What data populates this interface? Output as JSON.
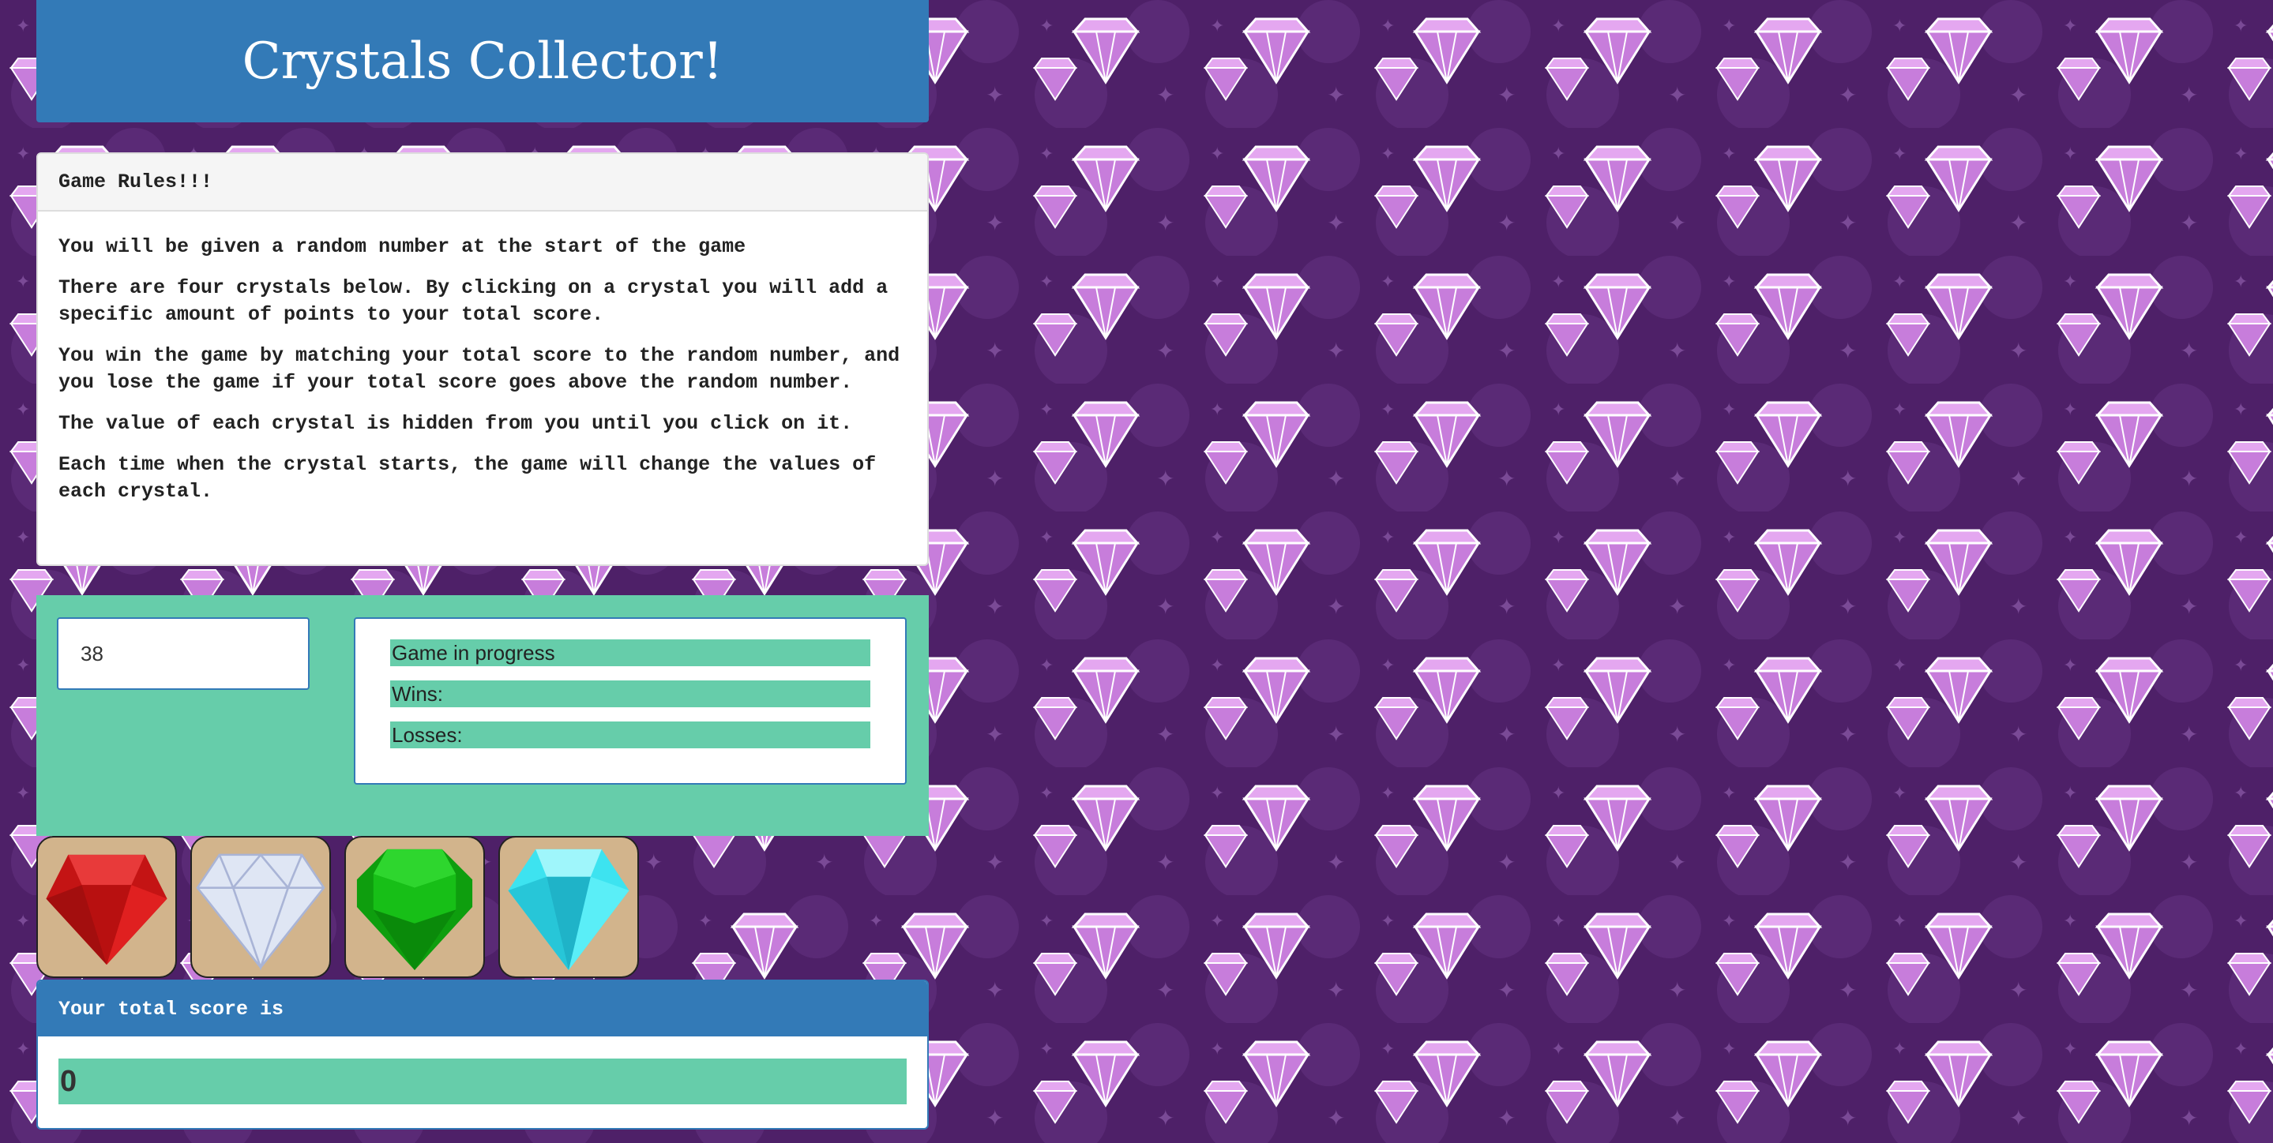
{
  "header": {
    "title": "Crystals Collector!"
  },
  "rules": {
    "heading": "Game Rules!!!",
    "items": [
      "You will be given a random number at the start of the game",
      "There are four crystals below. By clicking on a crystal you will add a specific amount of points to your total score.",
      "You win the game by matching your total score to the random number, and you lose the game if your total score goes above the random number.",
      "The value of each crystal is hidden from you until you click on it.",
      "Each time when the crystal starts, the game will change the values of each crystal."
    ]
  },
  "game": {
    "target_number": "38",
    "status": "Game in progress",
    "wins_label": "Wins:",
    "losses_label": "Losses:"
  },
  "crystals": [
    {
      "name": "red-crystal-icon",
      "color": "#d91a1a"
    },
    {
      "name": "white-crystal-icon",
      "color": "#dfe6f4"
    },
    {
      "name": "green-crystal-icon",
      "color": "#12b012"
    },
    {
      "name": "blue-crystal-icon",
      "color": "#3de3f0"
    }
  ],
  "score": {
    "label": "Your total score is",
    "value": "0"
  },
  "colors": {
    "background": "#4e2068",
    "accent_blue": "#337ab7",
    "accent_green": "#66cdaa",
    "crystal_tile": "#d2b48c",
    "pattern_diamond": "#c77ddb"
  }
}
